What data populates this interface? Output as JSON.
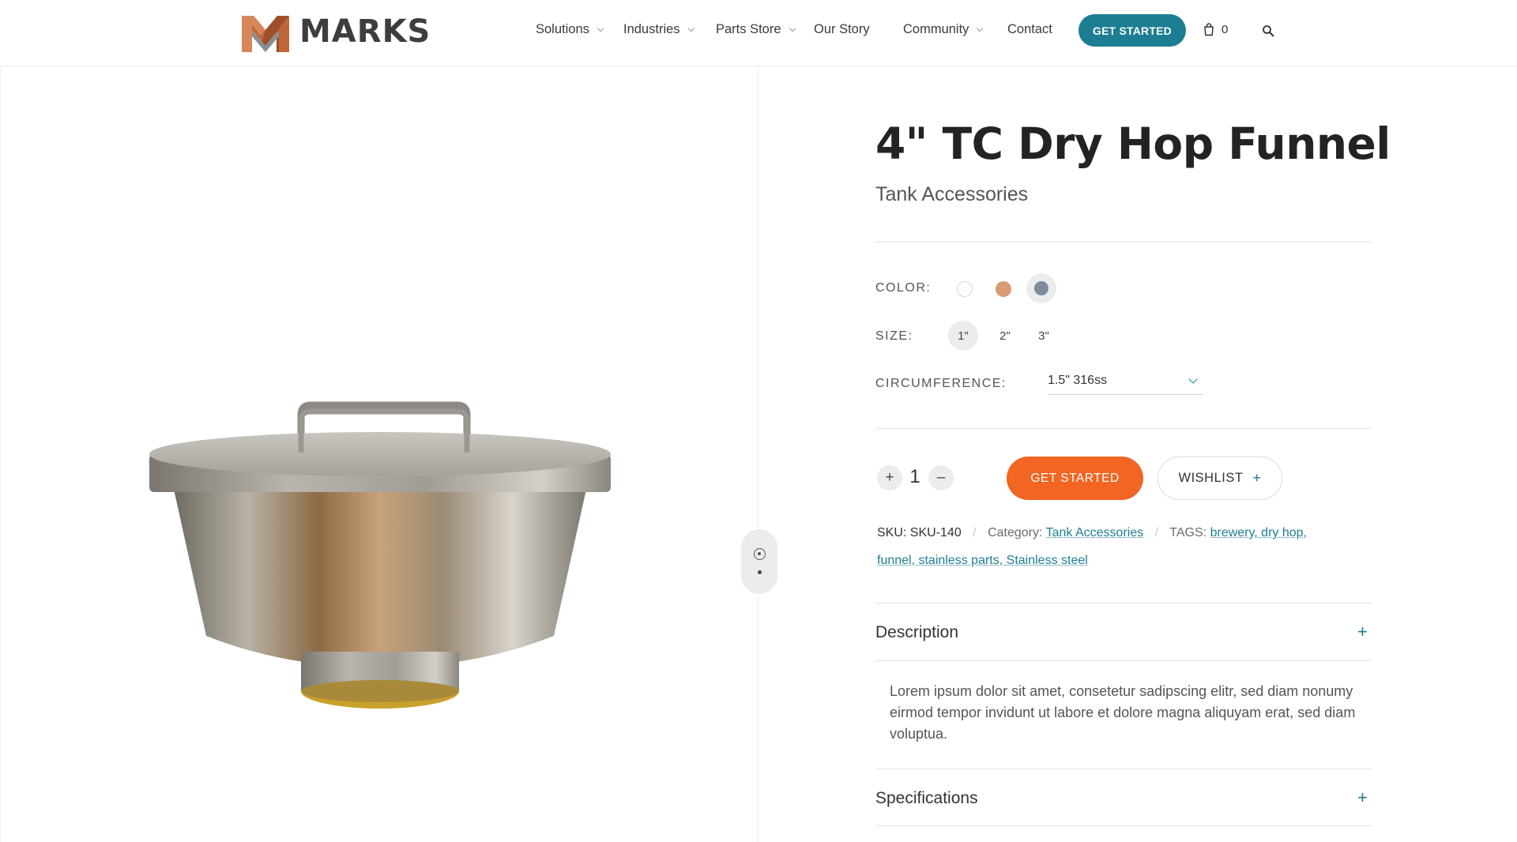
{
  "brand": {
    "name": "MARKS"
  },
  "nav": {
    "items": [
      {
        "label": "Solutions",
        "dropdown": true
      },
      {
        "label": "Industries",
        "dropdown": true
      },
      {
        "label": "Parts Store",
        "dropdown": true
      },
      {
        "label": "Our Story",
        "dropdown": false
      },
      {
        "label": "Community",
        "dropdown": true
      },
      {
        "label": "Contact",
        "dropdown": false
      }
    ],
    "cta_label": "GET STARTED",
    "cart_count": "0"
  },
  "product": {
    "title": "4\" TC Dry Hop Funnel",
    "subtitle": "Tank Accessories",
    "options": {
      "color_label": "COLOR:",
      "colors": [
        "#ffffff",
        "#d89b75",
        "#7d8b9e"
      ],
      "selected_color_index": 2,
      "size_label": "SIZE:",
      "sizes": [
        "1\"",
        "2\"",
        "3\""
      ],
      "selected_size_index": 0,
      "circumference_label": "CIRCUMFERENCE:",
      "circumference_value": "1.5\" 316ss"
    },
    "quantity": "1",
    "qty_plus": "+",
    "qty_minus": "–",
    "primary_label": "GET STARTED",
    "wishlist_label": "WISHLIST",
    "wishlist_plus": "+",
    "meta": {
      "sku_label": "SKU:",
      "sku": "SKU-140",
      "category_label": "Category:",
      "category": "Tank Accessories",
      "tags_label": "TAGS:",
      "tags_line1": "brewery, dry hop,",
      "tags_line2": "funnel, stainless parts, Stainless steel"
    },
    "accordion": [
      {
        "title": "Description",
        "icon": "+",
        "body": "Lorem ipsum dolor sit amet, consetetur sadipscing elitr, sed diam nonumy eirmod tempor invidunt ut labore et dolore magna aliquyam erat, sed diam voluptua."
      },
      {
        "title": "Specifications",
        "icon": "+"
      }
    ]
  },
  "colors": {
    "accent": "#1d7e93",
    "primary_button": "#f26522"
  }
}
